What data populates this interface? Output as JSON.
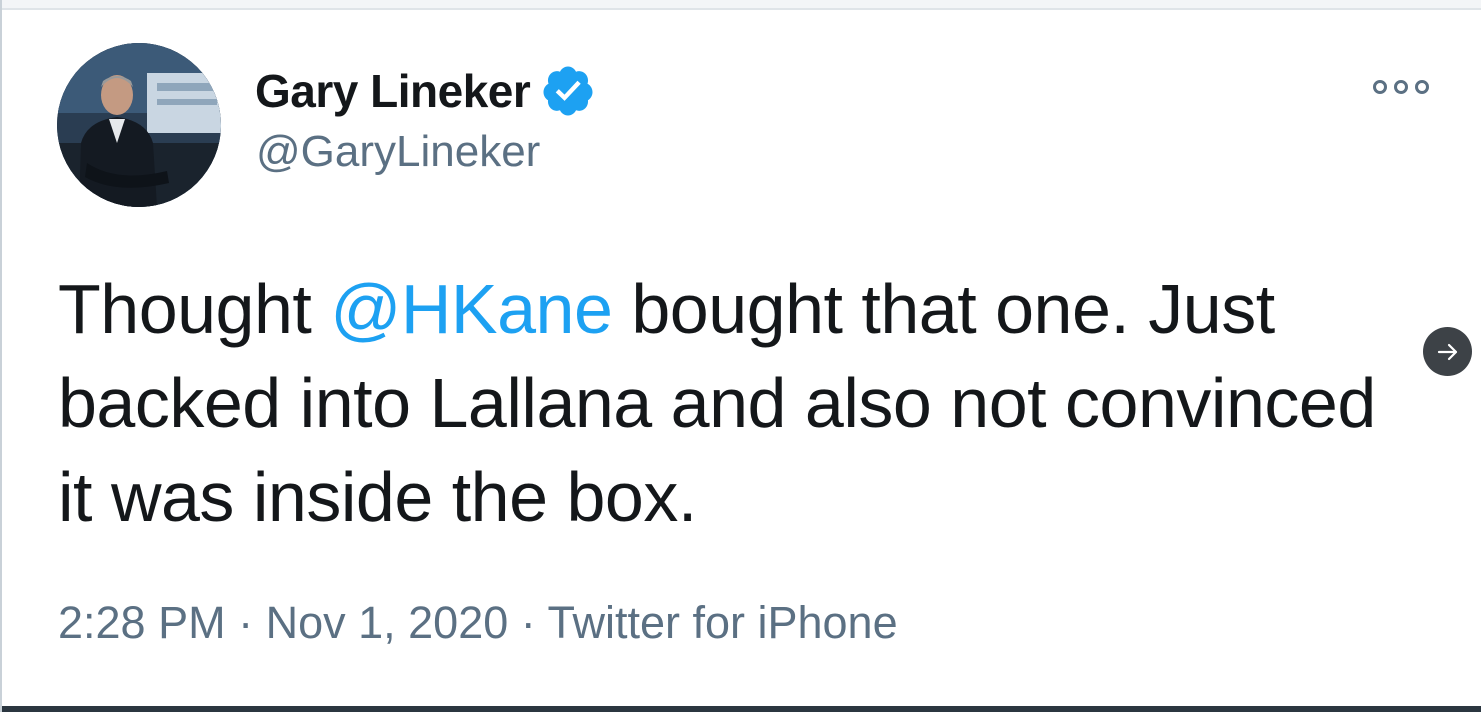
{
  "tweet": {
    "author": {
      "display_name": "Gary Lineker",
      "handle": "@GaryLineker",
      "verified": true
    },
    "text_before": "Thought ",
    "mention": "@HKane",
    "text_after": " bought that one. Just backed into Lallana and also not convinced it was inside the box.",
    "time": "2:28 PM",
    "date": "Nov 1, 2020",
    "source": "Twitter for iPhone",
    "separator": " · "
  },
  "icons": {
    "more": "more-options-icon",
    "verified": "verified-badge-icon",
    "next": "arrow-right-icon"
  },
  "colors": {
    "text": "#14171a",
    "secondary": "#5b7083",
    "link": "#1da1f2",
    "verified": "#1da1f2"
  }
}
